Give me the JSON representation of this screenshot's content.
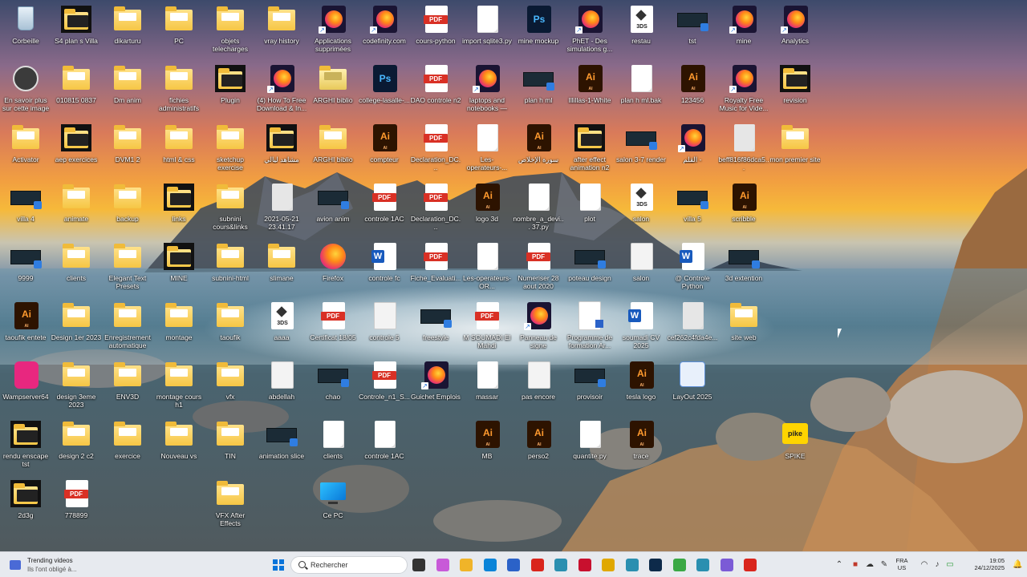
{
  "desktop": {
    "icons": [
      {
        "label": "Corbeille",
        "icon": "recycle-bin-icon"
      },
      {
        "label": "S4 plan s Villa",
        "icon": "folder-thumbnail-icon"
      },
      {
        "label": "dikarturu",
        "icon": "folder-icon"
      },
      {
        "label": "PC",
        "icon": "folder-icon"
      },
      {
        "label": "objets telecharges",
        "icon": "folder-icon"
      },
      {
        "label": "vray history",
        "icon": "folder-icon"
      },
      {
        "label": "Applications supprimées",
        "icon": "firefox-shortcut-icon"
      },
      {
        "label": "codefinity.com",
        "icon": "firefox-shortcut-icon"
      },
      {
        "label": "cours-python",
        "icon": "pdf-icon"
      },
      {
        "label": "import sqlite3.py",
        "icon": "file-icon"
      },
      {
        "label": "mine mockup",
        "icon": "photoshop-icon"
      },
      {
        "label": "PhET - Des simulations g...",
        "icon": "firefox-shortcut-icon"
      },
      {
        "label": "restau",
        "icon": "3ds-icon"
      },
      {
        "label": "tst",
        "icon": "video-icon"
      },
      {
        "label": "mine",
        "icon": "firefox-shortcut-icon"
      },
      {
        "label": "Analytics",
        "icon": "firefox-shortcut-icon"
      },
      {
        "label": "En savoir plus sur cette image",
        "icon": "info-circle-icon"
      },
      {
        "label": "010815 0837",
        "icon": "folder-icon"
      },
      {
        "label": "Dm anim",
        "icon": "folder-icon"
      },
      {
        "label": "fichies administratifs",
        "icon": "folder-icon"
      },
      {
        "label": "Plugin",
        "icon": "folder-thumbnail-icon"
      },
      {
        "label": "(4) How To Free Download & In...",
        "icon": "firefox-shortcut-icon"
      },
      {
        "label": "ARGHI biblio",
        "icon": "archive-icon"
      },
      {
        "label": "college-lasalle-...",
        "icon": "photoshop-icon"
      },
      {
        "label": "DAO controle n2",
        "icon": "pdf-icon"
      },
      {
        "label": "laptops and notebooks — trin...",
        "icon": "firefox-shortcut-icon"
      },
      {
        "label": "plan h ml",
        "icon": "video-icon"
      },
      {
        "label": "Illillas-1-White",
        "icon": "illustrator-icon"
      },
      {
        "label": "plan h ml.bak",
        "icon": "file-icon"
      },
      {
        "label": "123456",
        "icon": "illustrator-icon"
      },
      {
        "label": "Royalty Free Music for Vide...",
        "icon": "firefox-shortcut-icon"
      },
      {
        "label": "revision",
        "icon": "folder-thumbnail-icon"
      },
      {
        "label": "Activator",
        "icon": "folder-icon"
      },
      {
        "label": "aep exercices",
        "icon": "folder-thumbnail-icon"
      },
      {
        "label": "DVM1 2",
        "icon": "folder-icon"
      },
      {
        "label": "html & css",
        "icon": "folder-icon"
      },
      {
        "label": "sketchup exercise",
        "icon": "folder-icon"
      },
      {
        "label": "مشاهد ليالي",
        "icon": "folder-thumbnail-icon"
      },
      {
        "label": "ARGHI biblio",
        "icon": "folder-icon"
      },
      {
        "label": "compteur",
        "icon": "illustrator-icon"
      },
      {
        "label": "Declaration_DC...",
        "icon": "pdf-icon"
      },
      {
        "label": "Les-operateurs-...",
        "icon": "file-icon"
      },
      {
        "label": "سورة الإخلاص",
        "icon": "illustrator-icon"
      },
      {
        "label": "after effect animation n2",
        "icon": "folder-thumbnail-icon"
      },
      {
        "label": "salon 3-7 render",
        "icon": "video-icon"
      },
      {
        "label": "القلم -",
        "icon": "firefox-shortcut-icon"
      },
      {
        "label": "beff816f86dca5...",
        "icon": "image-icon"
      },
      {
        "label": "mon premier site",
        "icon": "folder-icon"
      },
      {
        "label": "villa 4",
        "icon": "video-icon"
      },
      {
        "label": "animate",
        "icon": "folder-icon"
      },
      {
        "label": "backup",
        "icon": "folder-icon"
      },
      {
        "label": "links",
        "icon": "folder-thumbnail-icon"
      },
      {
        "label": "subnini cours&links",
        "icon": "folder-icon"
      },
      {
        "label": "2021-05-21 23.41.17",
        "icon": "image-icon"
      },
      {
        "label": "avion anim",
        "icon": "video-icon"
      },
      {
        "label": "controle 1AC",
        "icon": "pdf-icon"
      },
      {
        "label": "Declaration_DC...",
        "icon": "pdf-icon"
      },
      {
        "label": "logo 3d",
        "icon": "illustrator-icon"
      },
      {
        "label": "nombre_a_devi... 37.py",
        "icon": "file-icon"
      },
      {
        "label": "plot",
        "icon": "file-icon"
      },
      {
        "label": "salon",
        "icon": "3ds-icon"
      },
      {
        "label": "villa 5",
        "icon": "video-icon"
      },
      {
        "label": "scribble",
        "icon": "illustrator-icon"
      },
      {
        "label": "9999",
        "icon": "video-icon"
      },
      {
        "label": "clients",
        "icon": "folder-icon"
      },
      {
        "label": "Elegant Text Presets",
        "icon": "folder-icon"
      },
      {
        "label": "MINE",
        "icon": "folder-thumbnail-icon"
      },
      {
        "label": "subnini-html",
        "icon": "folder-icon"
      },
      {
        "label": "slimane",
        "icon": "folder-icon"
      },
      {
        "label": "Firefox",
        "icon": "firefox-icon"
      },
      {
        "label": "controle fc",
        "icon": "word-icon"
      },
      {
        "label": "Fiche_Evaluati...",
        "icon": "pdf-icon"
      },
      {
        "label": "Les-operateurs-OR...",
        "icon": "file-icon"
      },
      {
        "label": "Numeriser 28 aout 2020",
        "icon": "pdf-icon"
      },
      {
        "label": "poteau design",
        "icon": "video-icon"
      },
      {
        "label": "salon",
        "icon": "sketchup-icon"
      },
      {
        "label": "@ Controle Python",
        "icon": "word-icon"
      },
      {
        "label": "3d extention",
        "icon": "video-icon"
      },
      {
        "label": "taoufik entete",
        "icon": "illustrator-icon"
      },
      {
        "label": "Design 1er 2023",
        "icon": "folder-icon"
      },
      {
        "label": "Enregistrement automatique",
        "icon": "folder-icon"
      },
      {
        "label": "montage",
        "icon": "folder-icon"
      },
      {
        "label": "taoufik",
        "icon": "folder-icon"
      },
      {
        "label": "aaaa",
        "icon": "3ds-icon"
      },
      {
        "label": "Certificat 18/05",
        "icon": "pdf-icon"
      },
      {
        "label": "controle 5",
        "icon": "sketchup-icon"
      },
      {
        "label": "freestyle",
        "icon": "video-icon"
      },
      {
        "label": "M SOUMADI El Mahdi",
        "icon": "pdf-icon"
      },
      {
        "label": "Panneau de signe",
        "icon": "firefox-shortcut-icon"
      },
      {
        "label": "Programme de formation Ar...",
        "icon": "program-icon"
      },
      {
        "label": "soumadi CV 2025",
        "icon": "word-icon"
      },
      {
        "label": "cef262c4fda4e...",
        "icon": "image-icon"
      },
      {
        "label": "site web",
        "icon": "folder-icon"
      },
      {
        "label": "Wampserver64",
        "icon": "wampserver-icon"
      },
      {
        "label": "design 3eme 2023",
        "icon": "folder-icon"
      },
      {
        "label": "ENV3D",
        "icon": "folder-icon"
      },
      {
        "label": "montage cours h1",
        "icon": "folder-icon"
      },
      {
        "label": "vfx",
        "icon": "folder-icon"
      },
      {
        "label": "abdellah",
        "icon": "sketchup-icon"
      },
      {
        "label": "chao",
        "icon": "video-icon"
      },
      {
        "label": "Controle_n1_S...",
        "icon": "pdf-icon"
      },
      {
        "label": "Guichet Emplois",
        "icon": "firefox-shortcut-icon"
      },
      {
        "label": "massar",
        "icon": "file-icon"
      },
      {
        "label": "pas encore",
        "icon": "sketchup-icon"
      },
      {
        "label": "provisoir",
        "icon": "video-icon"
      },
      {
        "label": "tesla logo",
        "icon": "illustrator-icon"
      },
      {
        "label": "LayOut 2025",
        "icon": "layout-icon"
      },
      {
        "label": "rendu enscape tst",
        "icon": "folder-thumbnail-icon"
      },
      {
        "label": "design 2 c2",
        "icon": "folder-icon"
      },
      {
        "label": "exercice",
        "icon": "folder-icon"
      },
      {
        "label": "Nouveau vs",
        "icon": "folder-icon"
      },
      {
        "label": "TIN",
        "icon": "folder-icon"
      },
      {
        "label": "animation slice",
        "icon": "video-icon"
      },
      {
        "label": "clients",
        "icon": "settings-file-icon"
      },
      {
        "label": "controle 1AC",
        "icon": "text-file-icon"
      },
      {
        "label": "MB",
        "icon": "illustrator-icon"
      },
      {
        "label": "perso2",
        "icon": "illustrator-icon"
      },
      {
        "label": "quantite.py",
        "icon": "file-icon"
      },
      {
        "label": "trace",
        "icon": "illustrator-icon"
      },
      {
        "label": "SPIKE",
        "icon": "spike-icon"
      },
      {
        "label": "2d3g",
        "icon": "folder-thumbnail-icon"
      },
      {
        "label": "778899",
        "icon": "pdf-icon"
      },
      {
        "label": "VFX After Effects Compositing",
        "icon": "folder-icon"
      },
      {
        "label": "Ce PC",
        "icon": "this-pc-icon"
      }
    ]
  },
  "taskbar": {
    "widget_title": "Trending videos",
    "widget_subtitle": "Ils l'ont obligé à...",
    "search_placeholder": "Rechercher",
    "language_top": "FRA",
    "language_bottom": "US",
    "time": "19:05",
    "date": "24/12/2025",
    "pinned_apps": [
      "task-view-icon",
      "copilot-icon",
      "file-explorer-icon",
      "edge-icon",
      "store-icon",
      "acrobat-icon",
      "3ds-max-icon",
      "sketchup-icon",
      "chrome-icon",
      "3ds-max-icon",
      "blender-icon",
      "camtasia-icon",
      "3ds-max-icon",
      "firefox-icon",
      "tools-icon"
    ]
  }
}
